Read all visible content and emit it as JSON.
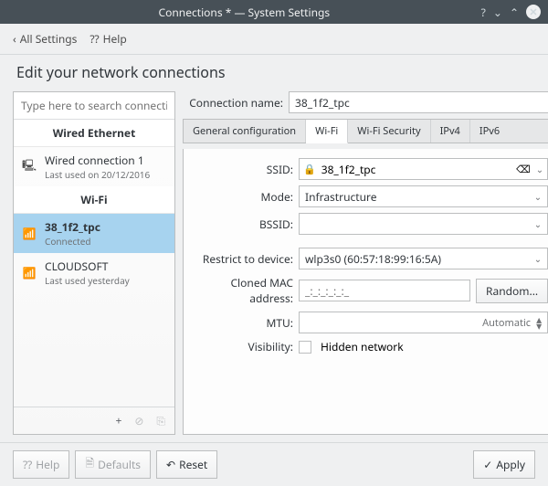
{
  "window": {
    "title": "Connections * — System Settings"
  },
  "topnav": {
    "back": "All Settings",
    "help": "Help"
  },
  "page": {
    "heading": "Edit your network connections"
  },
  "search": {
    "placeholder": "Type here to search connections..."
  },
  "groups": {
    "wired": {
      "header": "Wired Ethernet"
    },
    "wifi": {
      "header": "Wi-Fi"
    }
  },
  "connections": {
    "wired1": {
      "name": "Wired connection 1",
      "sub": "Last used on 20/12/2016"
    },
    "wifi1": {
      "name": "38_1f2_tpc",
      "sub": "Connected"
    },
    "wifi2": {
      "name": "CLOUDSOFT",
      "sub": "Last used yesterday"
    }
  },
  "form": {
    "conn_name_label": "Connection name:",
    "conn_name_value": "38_1f2_tpc",
    "tabs": {
      "general": "General configuration",
      "wifi": "Wi-Fi",
      "security": "Wi-Fi Security",
      "ipv4": "IPv4",
      "ipv6": "IPv6"
    },
    "ssid_label": "SSID:",
    "ssid_value": "38_1f2_tpc",
    "mode_label": "Mode:",
    "mode_value": "Infrastructure",
    "bssid_label": "BSSID:",
    "bssid_value": "",
    "restrict_label": "Restrict to device:",
    "restrict_value": "wlp3s0 (60:57:18:99:16:5A)",
    "mac_label": "Cloned MAC address:",
    "mac_placeholder": "_:_:_:_:_:_",
    "random_btn": "Random...",
    "mtu_label": "MTU:",
    "mtu_value": "Automatic",
    "visibility_label": "Visibility:",
    "visibility_check": "Hidden network"
  },
  "bottom": {
    "help": "Help",
    "defaults": "Defaults",
    "reset": "Reset",
    "apply": "Apply"
  }
}
